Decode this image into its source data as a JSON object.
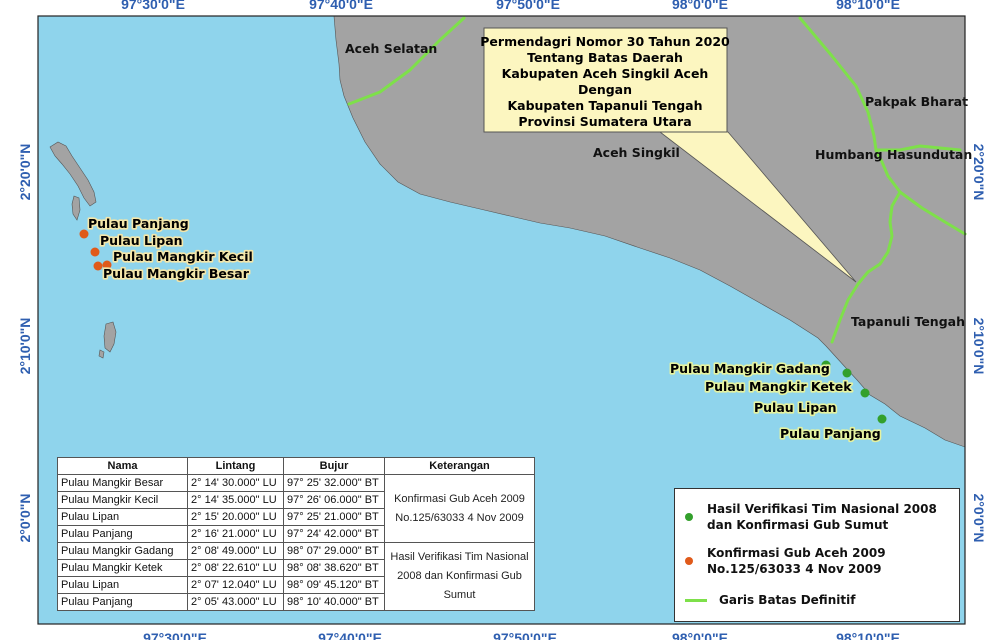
{
  "grid_labels": {
    "top": [
      "97°30'0\"E",
      "97°40'0\"E",
      "97°50'0\"E",
      "98°0'0\"E",
      "98°10'0\"E"
    ],
    "bottom": [
      "97°30'0\"E",
      "97°40'0\"E",
      "97°50'0\"E",
      "98°0'0\"E",
      "98°10'0\"E"
    ],
    "left": [
      "2°20'0\"N",
      "2°10'0\"N",
      "2°0'0\"N"
    ],
    "right": [
      "2°20'0\"N",
      "2°10'0\"N",
      "2°0'0\"N"
    ]
  },
  "callout": {
    "lines": [
      "Permendagri Nomor 30 Tahun 2020",
      "Tentang Batas Daerah",
      "Kabupaten Aceh Singkil Aceh",
      "Dengan",
      "Kabupaten Tapanuli Tengah",
      "Provinsi Sumatera Utara"
    ]
  },
  "regions": {
    "aceh_selatan": "Aceh Selatan",
    "aceh_singkil": "Aceh Singkil",
    "pakpak_bharat": "Pakpak Bharat",
    "humbang_hasundutan": "Humbang Hasundutan",
    "tapanuli_tengah": "Tapanuli Tengah"
  },
  "islands_west": [
    "Pulau Panjang",
    "Pulau Lipan",
    "Pulau Mangkir Kecil",
    "Pulau Mangkir Besar"
  ],
  "islands_east": [
    "Pulau Mangkir Gadang",
    "Pulau Mangkir Ketek",
    "Pulau Lipan",
    "Pulau Panjang"
  ],
  "table": {
    "headers": [
      "Nama",
      "Lintang",
      "Bujur",
      "Keterangan"
    ],
    "rows": [
      {
        "nama": "Pulau Mangkir Besar",
        "lintang": "2° 14' 30.000\" LU",
        "bujur": "97° 25' 32.000\" BT"
      },
      {
        "nama": "Pulau Mangkir Kecil",
        "lintang": "2° 14' 35.000\" LU",
        "bujur": "97° 26' 06.000\" BT"
      },
      {
        "nama": "Pulau Lipan",
        "lintang": "2° 15' 20.000\" LU",
        "bujur": "97° 25' 21.000\" BT"
      },
      {
        "nama": "Pulau Panjang",
        "lintang": "2° 16' 21.000\" LU",
        "bujur": "97° 24' 42.000\" BT"
      },
      {
        "nama": "Pulau Mangkir Gadang",
        "lintang": "2° 08' 49.000\" LU",
        "bujur": "98° 07' 29.000\" BT"
      },
      {
        "nama": "Pulau Mangkir Ketek",
        "lintang": "2° 08' 22.610\" LU",
        "bujur": "98° 08' 38.620\" BT"
      },
      {
        "nama": "Pulau Lipan",
        "lintang": "2° 07' 12.040\" LU",
        "bujur": "98° 09' 45.120\" BT"
      },
      {
        "nama": "Pulau Panjang",
        "lintang": "2° 05' 43.000\" LU",
        "bujur": "98° 10' 40.000\" BT"
      }
    ],
    "keterangan_1": "Konfirmasi Gub Aceh 2009 No.125/63033 4 Nov 2009",
    "keterangan_2": "Hasil Verifikasi Tim Nasional 2008 dan Konfirmasi Gub Sumut"
  },
  "legend": {
    "green_label": "Hasil Verifikasi Tim Nasional 2008 dan Konfirmasi Gub Sumut",
    "green_color": "#33a02c",
    "orange_label": "Konfirmasi Gub Aceh 2009 No.125/63033 4 Nov 2009",
    "orange_color": "#e05a1a",
    "line_label": "Garis Batas Definitif",
    "line_color": "#7ee04a"
  },
  "colors": {
    "sea": "#8fd4ec",
    "land": "#a3a3a3",
    "callout_fill": "#fcf6c0",
    "grid_label": "#2f5fb0"
  }
}
